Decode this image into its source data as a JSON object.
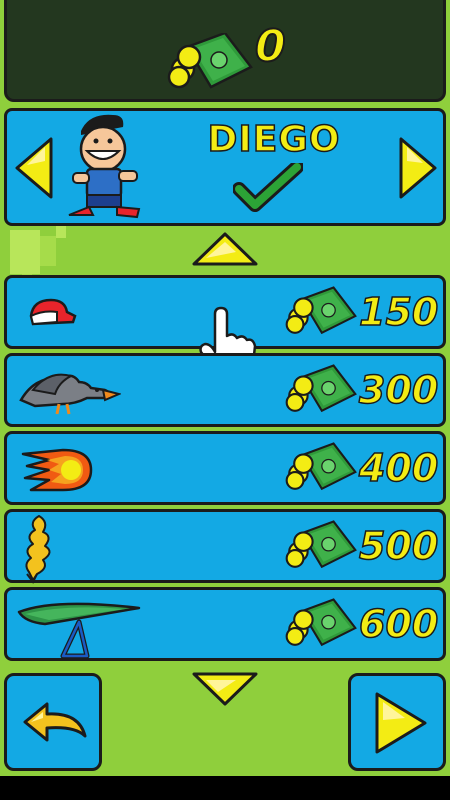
{
  "money": {
    "balance": "0",
    "icon": "cash-icon"
  },
  "character": {
    "name": "DIEGO",
    "selected": true
  },
  "shop_items": [
    {
      "icon": "red-cap-icon",
      "price": "150"
    },
    {
      "icon": "goose-icon",
      "price": "300"
    },
    {
      "icon": "fireball-icon",
      "price": "400"
    },
    {
      "icon": "flame-trail-icon",
      "price": "500"
    },
    {
      "icon": "hang-glider-icon",
      "price": "600"
    }
  ],
  "colors": {
    "panel": "#13a9e4",
    "accent": "#f3ec14",
    "background": "#8fcf3c"
  }
}
